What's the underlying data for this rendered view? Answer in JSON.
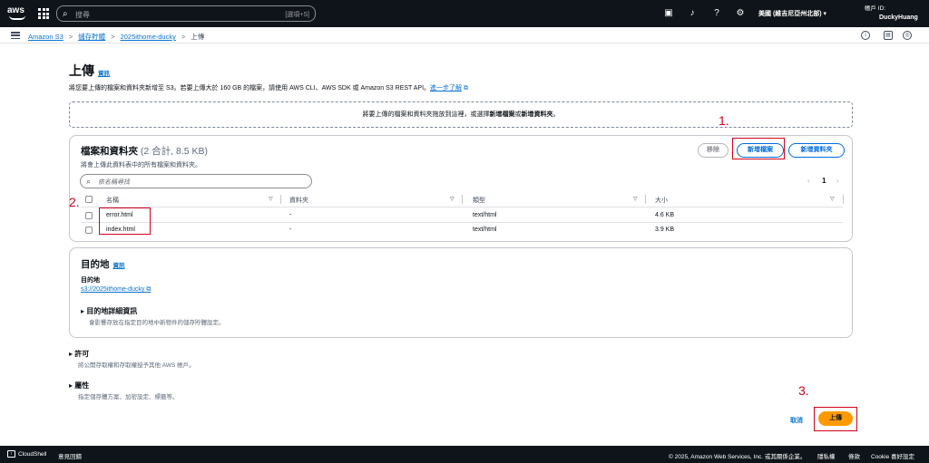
{
  "header": {
    "logo": "aws",
    "search_placeholder": "搜尋",
    "search_shortcut": "[選項+S]",
    "region": "美國 (維吉尼亞州北部) ▾",
    "account_id": "帳戶 ID:",
    "account_name": "DuckyHuang"
  },
  "breadcrumb": {
    "items": [
      "Amazon S3",
      "儲存貯體",
      "2025ithome-ducky"
    ],
    "current": "上傳",
    "separator": ">"
  },
  "page": {
    "title": "上傳",
    "info": "資訊",
    "description": "將您要上傳的檔案和資料夾新增至 S3。若要上傳大於 160 GB 的檔案，請使用 AWS CLI、AWS SDK 或 Amazon S3 REST API。",
    "learn_more": "進一步了解"
  },
  "dropzone": {
    "text_before": "將要上傳的檔案和資料夾拖放到這裡，或選擇",
    "add_files": "新增檔案",
    "or": "或",
    "add_folder": "新增資料夾",
    "end": "。"
  },
  "files_panel": {
    "title": "檔案和資料夾",
    "count": "(2 合計, 8.5 KB)",
    "subtitle": "將會上傳此資料表中的所有檔案和資料夾。",
    "remove_label": "移除",
    "add_files_label": "新增檔案",
    "add_folder_label": "新增資料夾",
    "search_placeholder": "依名稱尋找",
    "page": "1",
    "columns": [
      "名稱",
      "資料夾",
      "類型",
      "大小"
    ],
    "rows": [
      {
        "name": "error.html",
        "folder": "-",
        "type": "text/html",
        "size": "4.6 KB"
      },
      {
        "name": "index.html",
        "folder": "-",
        "type": "text/html",
        "size": "3.9 KB"
      }
    ]
  },
  "destination": {
    "title": "目的地",
    "info": "資訊",
    "label": "目的地",
    "link": "s3://2025ithome-ducky",
    "details_title": "目的地詳細資訊",
    "details_sub": "會影響存放在指定目的地中新物件的儲存貯體設定。"
  },
  "permissions": {
    "title": "許可",
    "sub": "將公開存取權和存取權授予其他 AWS 帳戶。"
  },
  "properties": {
    "title": "屬性",
    "sub": "指定儲存體方案、加密設定、標籤等。"
  },
  "actions": {
    "cancel": "取消",
    "upload": "上傳"
  },
  "annotations": {
    "step1": "1.",
    "step2": "2.",
    "step3": "3.",
    "color": "#d0021b"
  },
  "footer": {
    "cloudshell": "CloudShell",
    "feedback": "意見回饋",
    "copyright": "© 2025, Amazon Web Services, Inc. 或其關係企業。",
    "privacy": "隱私權",
    "terms": "條款",
    "cookie": "Cookie 喜好設定"
  },
  "colors": {
    "topbar": "#0f141a",
    "link": "#0972d3",
    "primary": "#ff9900",
    "button_border": "#006ce0"
  }
}
